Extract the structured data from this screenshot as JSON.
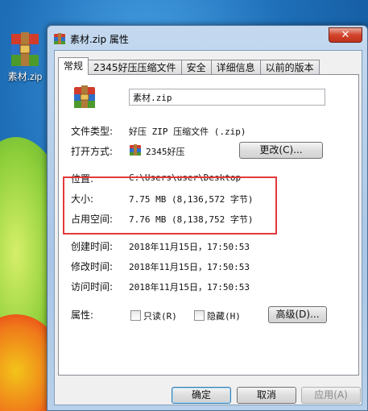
{
  "desktop": {
    "file_icon_label": "素材.zip"
  },
  "window": {
    "title": "素材.zip 属性",
    "close_label": "✕"
  },
  "tabs": [
    {
      "label": "常规",
      "active": true
    },
    {
      "label": "2345好压压缩文件",
      "active": false
    },
    {
      "label": "安全",
      "active": false
    },
    {
      "label": "详细信息",
      "active": false
    },
    {
      "label": "以前的版本",
      "active": false
    }
  ],
  "general": {
    "file_name": "素材.zip",
    "file_type_label": "文件类型:",
    "file_type_value": "好压 ZIP 压缩文件 (.zip)",
    "opens_with_label": "打开方式:",
    "opens_with_value": "2345好压",
    "change_button": "更改(C)...",
    "location_label": "位置:",
    "location_value": "C:\\Users\\user\\Desktop",
    "size_label": "大小:",
    "size_value": "7.75 MB (8,136,572 字节)",
    "size_on_disk_label": "占用空间:",
    "size_on_disk_value": "7.76 MB (8,138,752 字节)",
    "created_label": "创建时间:",
    "created_value": "2018年11月15日，17:50:53",
    "modified_label": "修改时间:",
    "modified_value": "2018年11月15日，17:50:53",
    "accessed_label": "访问时间:",
    "accessed_value": "2018年11月15日，17:50:53",
    "attributes_label": "属性:",
    "readonly_label": "只读(R)",
    "hidden_label": "隐藏(H)",
    "advanced_button": "高级(D)..."
  },
  "footer": {
    "ok": "确定",
    "cancel": "取消",
    "apply": "应用(A)"
  },
  "colors": {
    "highlight_box": "#e33a3a",
    "close_button": "#c1321c"
  }
}
